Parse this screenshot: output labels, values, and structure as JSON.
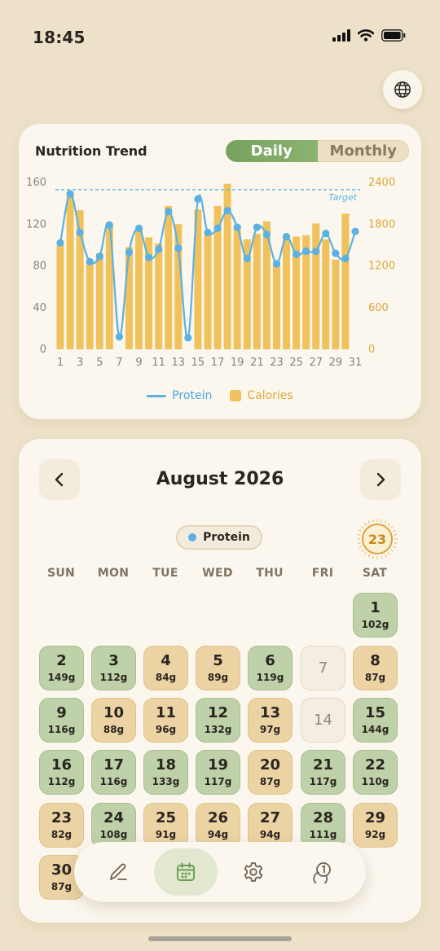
{
  "status_bar": {
    "time": "18:45"
  },
  "trend_card": {
    "title": "Nutrition Trend",
    "tabs": [
      {
        "label": "Daily",
        "active": true
      },
      {
        "label": "Monthly",
        "active": false
      }
    ]
  },
  "chart_data": {
    "type": "bar",
    "x": [
      1,
      2,
      3,
      4,
      5,
      6,
      7,
      8,
      9,
      10,
      11,
      12,
      13,
      14,
      15,
      16,
      17,
      18,
      19,
      20,
      21,
      22,
      23,
      24,
      25,
      26,
      27,
      28,
      29,
      30,
      31
    ],
    "x_tick_labels": [
      "1",
      "3",
      "5",
      "7",
      "9",
      "11",
      "13",
      "15",
      "17",
      "19",
      "21",
      "23",
      "25",
      "27",
      "29",
      "31"
    ],
    "series": [
      {
        "name": "Calories",
        "kind": "bar",
        "axis": "right",
        "color": "#f1c25c",
        "values": [
          1500,
          2250,
          2000,
          1280,
          1380,
          1770,
          null,
          1470,
          1740,
          1610,
          1520,
          2060,
          1800,
          null,
          2010,
          1650,
          2060,
          2380,
          1770,
          1580,
          1660,
          1840,
          1210,
          1610,
          1620,
          1640,
          1810,
          1580,
          1290,
          1950,
          null
        ]
      },
      {
        "name": "Protein",
        "kind": "line",
        "axis": "left",
        "color": "#5ab1e2",
        "values": [
          102,
          149,
          112,
          84,
          89,
          119,
          12,
          93,
          116,
          88,
          96,
          132,
          97,
          11,
          144,
          112,
          116,
          133,
          117,
          87,
          117,
          110,
          82,
          108,
          91,
          94,
          94,
          111,
          92,
          87,
          113
        ]
      }
    ],
    "left_axis": {
      "ticks": [
        0,
        40,
        80,
        120,
        160
      ],
      "ylim": [
        0,
        160
      ]
    },
    "right_axis": {
      "ticks": [
        0,
        600,
        1200,
        1800,
        2400
      ],
      "ylim": [
        0,
        2400
      ]
    },
    "target_line": {
      "value": 153,
      "label": "Target"
    },
    "legend": [
      "Protein",
      "Calories"
    ]
  },
  "calendar": {
    "month_title": "August 2026",
    "filter_chip": "Protein",
    "today": "23",
    "weekdays": [
      "SUN",
      "MON",
      "TUE",
      "WED",
      "THU",
      "FRI",
      "SAT"
    ],
    "days": [
      {
        "d": "1",
        "v": "102g",
        "s": "g"
      },
      {
        "d": "2",
        "v": "149g",
        "s": "g"
      },
      {
        "d": "3",
        "v": "112g",
        "s": "g"
      },
      {
        "d": "4",
        "v": "84g",
        "s": "o"
      },
      {
        "d": "5",
        "v": "89g",
        "s": "o"
      },
      {
        "d": "6",
        "v": "119g",
        "s": "g"
      },
      {
        "d": "7",
        "v": "",
        "s": "e"
      },
      {
        "d": "8",
        "v": "87g",
        "s": "o"
      },
      {
        "d": "9",
        "v": "116g",
        "s": "g"
      },
      {
        "d": "10",
        "v": "88g",
        "s": "o"
      },
      {
        "d": "11",
        "v": "96g",
        "s": "o"
      },
      {
        "d": "12",
        "v": "132g",
        "s": "g"
      },
      {
        "d": "13",
        "v": "97g",
        "s": "o"
      },
      {
        "d": "14",
        "v": "",
        "s": "e"
      },
      {
        "d": "15",
        "v": "144g",
        "s": "g"
      },
      {
        "d": "16",
        "v": "112g",
        "s": "g"
      },
      {
        "d": "17",
        "v": "116g",
        "s": "g"
      },
      {
        "d": "18",
        "v": "133g",
        "s": "g"
      },
      {
        "d": "19",
        "v": "117g",
        "s": "g"
      },
      {
        "d": "20",
        "v": "87g",
        "s": "o"
      },
      {
        "d": "21",
        "v": "117g",
        "s": "g"
      },
      {
        "d": "22",
        "v": "110g",
        "s": "g"
      },
      {
        "d": "23",
        "v": "82g",
        "s": "o"
      },
      {
        "d": "24",
        "v": "108g",
        "s": "g"
      },
      {
        "d": "25",
        "v": "91g",
        "s": "o"
      },
      {
        "d": "26",
        "v": "94g",
        "s": "o"
      },
      {
        "d": "27",
        "v": "94g",
        "s": "o"
      },
      {
        "d": "28",
        "v": "111g",
        "s": "g"
      },
      {
        "d": "29",
        "v": "92g",
        "s": "o"
      },
      {
        "d": "30",
        "v": "87g",
        "s": "o"
      }
    ]
  },
  "tab_bar": {
    "items": [
      {
        "icon": "pencil-icon",
        "active": false
      },
      {
        "icon": "calendar-icon",
        "active": true
      },
      {
        "icon": "gear-icon",
        "active": false
      },
      {
        "icon": "coins-icon",
        "active": false
      }
    ]
  },
  "colors": {
    "accent_green": "#7eaa64",
    "calorie_bar": "#f1c25c",
    "protein_line": "#5ab1e2",
    "today_ring": "#e0a13b"
  }
}
